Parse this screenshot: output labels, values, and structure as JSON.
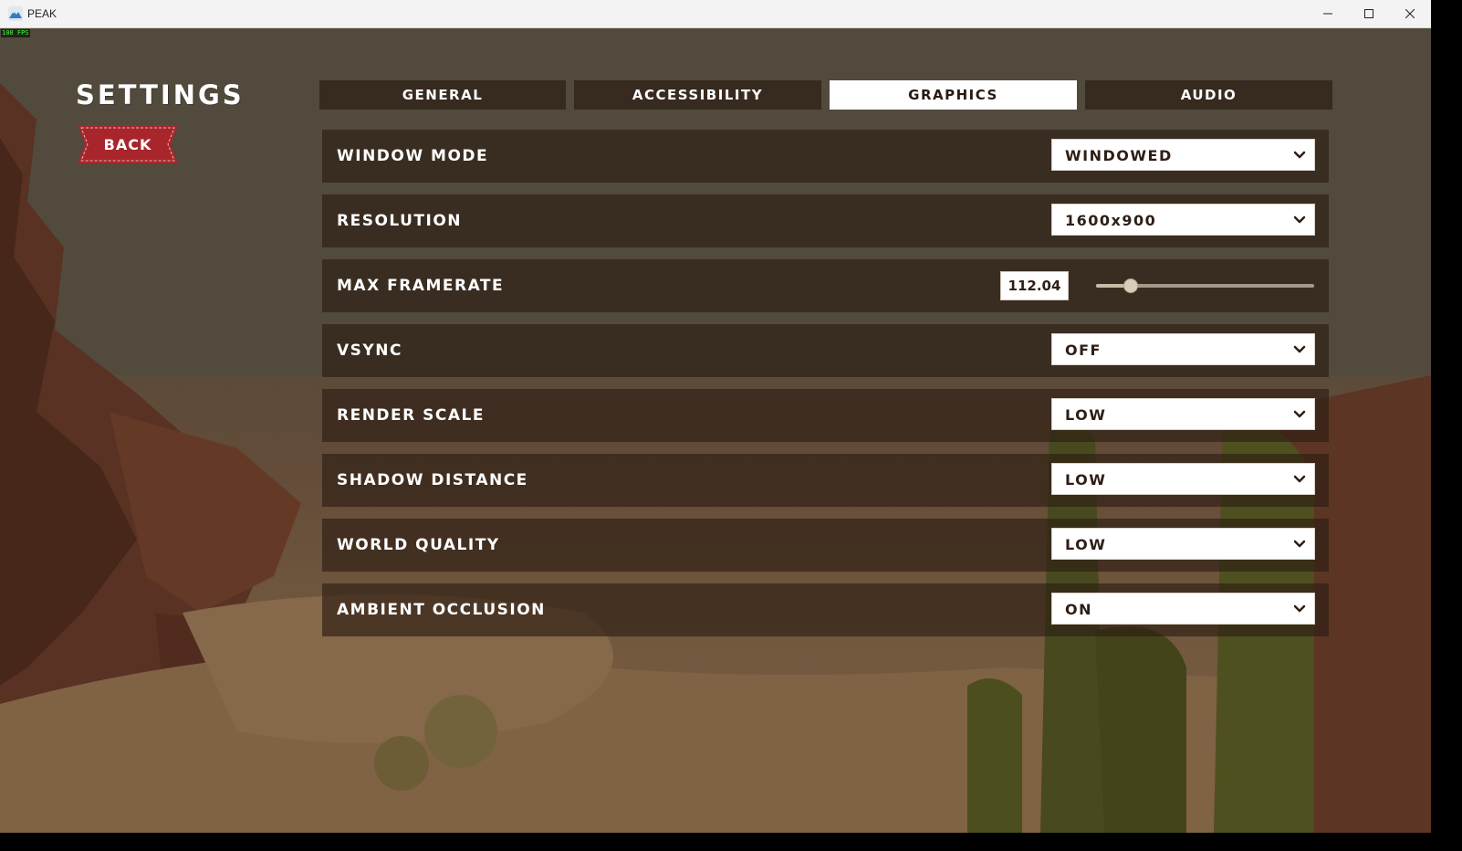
{
  "window": {
    "title": "PEAK",
    "controls": {
      "minimize": "minimize",
      "maximize": "maximize",
      "close": "close"
    }
  },
  "overlay": {
    "fps": "108 FPS"
  },
  "settings": {
    "heading": "SETTINGS",
    "back_label": "BACK",
    "tabs": [
      {
        "label": "GENERAL",
        "active": false
      },
      {
        "label": "ACCESSIBILITY",
        "active": false
      },
      {
        "label": "GRAPHICS",
        "active": true
      },
      {
        "label": "AUDIO",
        "active": false
      }
    ],
    "rows": [
      {
        "label": "WINDOW MODE",
        "type": "dropdown",
        "value": "WINDOWED"
      },
      {
        "label": "RESOLUTION",
        "type": "dropdown",
        "value": "1600x900"
      },
      {
        "label": "MAX FRAMERATE",
        "type": "slider",
        "value": "112.04",
        "slider_fraction": 0.16
      },
      {
        "label": "VSYNC",
        "type": "dropdown",
        "value": "OFF"
      },
      {
        "label": "RENDER SCALE",
        "type": "dropdown",
        "value": "LOW"
      },
      {
        "label": "SHADOW DISTANCE",
        "type": "dropdown",
        "value": "LOW"
      },
      {
        "label": "WORLD QUALITY",
        "type": "dropdown",
        "value": "LOW"
      },
      {
        "label": "AMBIENT OCCLUSION",
        "type": "dropdown",
        "value": "ON"
      }
    ]
  },
  "colors": {
    "accent_back_button": "#a8262b",
    "panel_bg": "#2e1e14",
    "active_tab": "#ffffff"
  },
  "icons": {
    "app": "mountain-icon",
    "dropdown": "chevron-down-icon"
  }
}
